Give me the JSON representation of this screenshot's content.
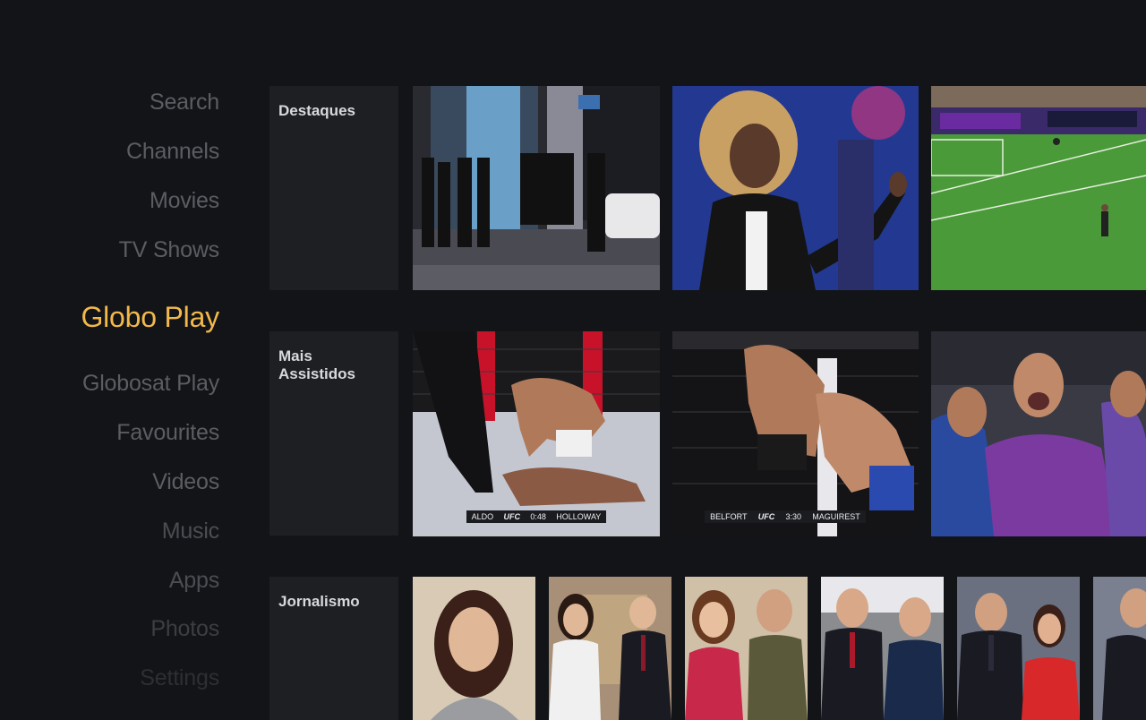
{
  "nav": {
    "items": [
      {
        "label": "Search"
      },
      {
        "label": "Channels"
      },
      {
        "label": "Movies"
      },
      {
        "label": "TV Shows"
      },
      {
        "label": "Globo Play"
      },
      {
        "label": "Globosat Play"
      },
      {
        "label": "Favourites"
      },
      {
        "label": "Videos"
      },
      {
        "label": "Music"
      },
      {
        "label": "Apps"
      },
      {
        "label": "Photos"
      },
      {
        "label": "Settings"
      }
    ],
    "active": "Globo Play"
  },
  "rows": [
    {
      "title": "Destaques"
    },
    {
      "title": "Mais Assistidos"
    },
    {
      "title": "Jornalismo"
    }
  ],
  "tiles": {
    "mais_assistidos": {
      "scoreboard_1": {
        "left": "ALDO",
        "brand": "UFC",
        "time": "0:48",
        "right": "HOLLOWAY"
      },
      "scoreboard_2": {
        "left": "BELFORT",
        "brand": "UFC",
        "time": "3:30",
        "right": "MAGUIREST"
      }
    }
  },
  "colors": {
    "accent": "#f2b84b",
    "background": "#121418",
    "label_panel": "#1d1f23"
  }
}
